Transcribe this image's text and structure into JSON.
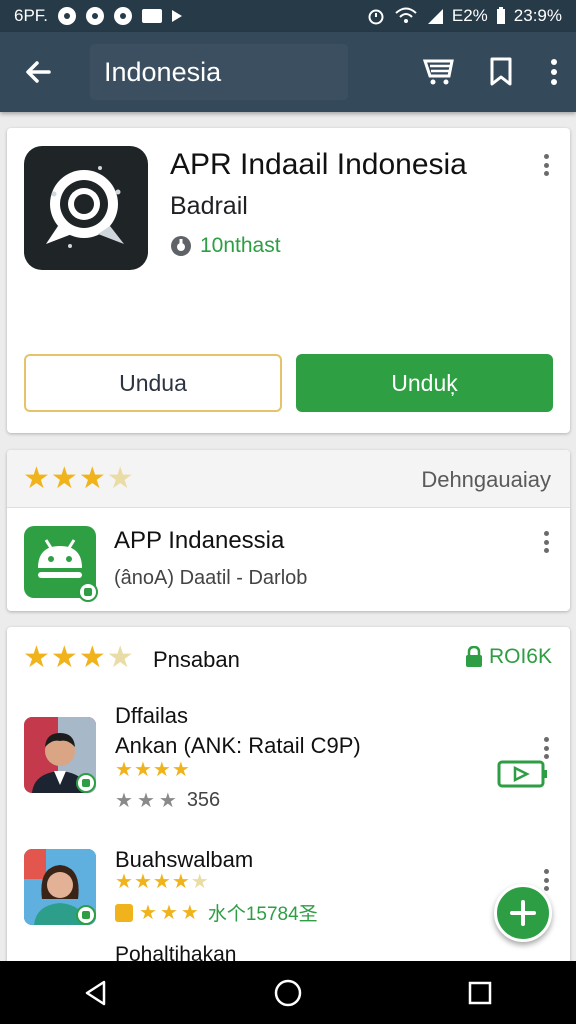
{
  "status_bar": {
    "left_text": "6PF.",
    "battery": "E2%",
    "time": "23:9%"
  },
  "app_bar": {
    "title": "Indonesia",
    "icons": [
      "back-arrow-icon",
      "cart-icon",
      "bookmark-icon",
      "more-vert-icon"
    ]
  },
  "app_header": {
    "name": "APR Indaail Indonesia",
    "developer": "Badrail",
    "meta": "10nthast",
    "button_outline": "Undua",
    "button_primary": "Unduķ"
  },
  "rating_card": {
    "stars": 3.5,
    "right_text": "Dehngauaiay",
    "app_name": "APP Indanessia",
    "app_sub": "(ânoA) Daatil - Darlob"
  },
  "reviews": {
    "stars": 3.5,
    "label": "Pnsaban",
    "badge": "ROI6K",
    "section_title": "Dffailas",
    "items": [
      {
        "line": "Ankan (ANK: Ratail  C9P)",
        "stars": 4,
        "rating_count": "356"
      },
      {
        "name": "Buahswalbam",
        "stars": 4.5,
        "extra": "水个15784圣"
      }
    ],
    "footer": "Pohaltihakan"
  },
  "colors": {
    "green": "#2ea043",
    "appbar": "#34495a",
    "status": "#263a48",
    "star": "#f0b31c"
  }
}
